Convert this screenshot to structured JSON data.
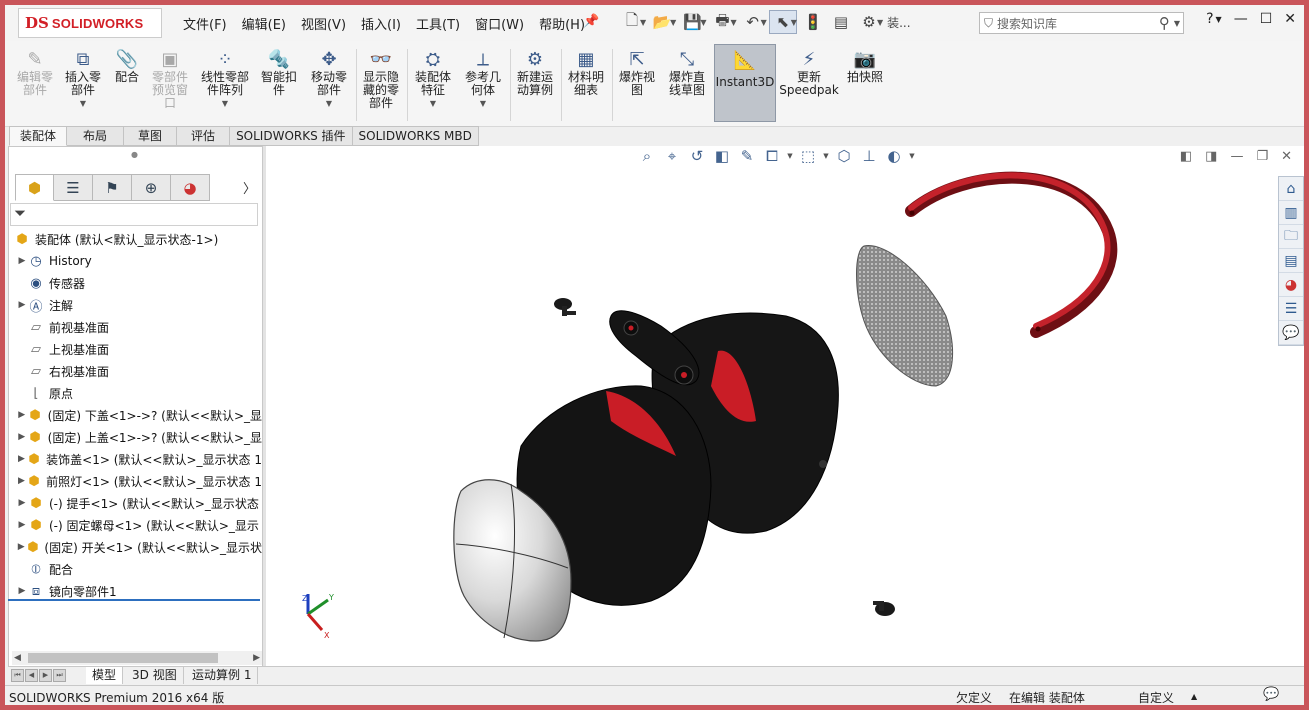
{
  "app": {
    "logo_ds": "DS",
    "logo_text": "SOLIDWORKS"
  },
  "menu": [
    "文件(F)",
    "编辑(E)",
    "视图(V)",
    "插入(I)",
    "工具(T)",
    "窗口(W)",
    "帮助(H)"
  ],
  "quick_access": {
    "assembly_label": "装...",
    "search_placeholder": "搜索知识库",
    "help": "?"
  },
  "ribbon": {
    "buttons": [
      {
        "label": "编辑零\n部件",
        "icon": "edit-component-icon",
        "disabled": true
      },
      {
        "label": "插入零\n部件",
        "icon": "insert-component-icon",
        "disabled": false
      },
      {
        "label": "配合",
        "icon": "mate-icon",
        "disabled": false
      },
      {
        "label": "零部件\n预览窗\n口",
        "icon": "component-preview-icon",
        "disabled": true
      },
      {
        "label": "线性零部\n件阵列",
        "icon": "linear-pattern-icon",
        "disabled": false
      },
      {
        "label": "智能扣\n件",
        "icon": "smart-fasteners-icon",
        "disabled": false
      },
      {
        "label": "移动零\n部件",
        "icon": "move-component-icon",
        "disabled": false
      },
      {
        "label": "显示隐\n藏的零\n部件",
        "icon": "show-hidden-icon",
        "disabled": false
      },
      {
        "label": "装配体\n特征",
        "icon": "assembly-features-icon",
        "disabled": false
      },
      {
        "label": "参考几\n何体",
        "icon": "reference-geometry-icon",
        "disabled": false
      },
      {
        "label": "新建运\n动算例",
        "icon": "new-motion-study-icon",
        "disabled": false
      },
      {
        "label": "材料明\n细表",
        "icon": "bom-icon",
        "disabled": false
      },
      {
        "label": "爆炸视\n图",
        "icon": "exploded-view-icon",
        "disabled": false
      },
      {
        "label": "爆炸直\n线草图",
        "icon": "explode-line-sketch-icon",
        "disabled": false
      },
      {
        "label": "Instant3D",
        "icon": "instant3d-icon",
        "disabled": false,
        "active": true
      },
      {
        "label": "更新\nSpeedpak",
        "icon": "speedpak-icon",
        "disabled": false
      },
      {
        "label": "拍快照",
        "icon": "snapshot-icon",
        "disabled": false
      }
    ]
  },
  "command_tabs": [
    "装配体",
    "布局",
    "草图",
    "评估",
    "SOLIDWORKS 插件",
    "SOLIDWORKS MBD"
  ],
  "feature_tree": {
    "root": "装配体  (默认<默认_显示状态-1>)",
    "items": [
      {
        "label": "History",
        "icon": "history-icon",
        "expandable": true
      },
      {
        "label": "传感器",
        "icon": "sensor-icon",
        "expandable": false
      },
      {
        "label": "注解",
        "icon": "annotation-icon",
        "expandable": true
      },
      {
        "label": "前视基准面",
        "icon": "plane-icon",
        "expandable": false
      },
      {
        "label": "上视基准面",
        "icon": "plane-icon",
        "expandable": false
      },
      {
        "label": "右视基准面",
        "icon": "plane-icon",
        "expandable": false
      },
      {
        "label": "原点",
        "icon": "origin-icon",
        "expandable": false
      },
      {
        "label": "(固定) 下盖<1>->? (默认<<默认>_显",
        "icon": "part-icon",
        "expandable": true
      },
      {
        "label": "(固定) 上盖<1>->? (默认<<默认>_显",
        "icon": "part-icon",
        "expandable": true
      },
      {
        "label": "装饰盖<1> (默认<<默认>_显示状态 1",
        "icon": "part-icon",
        "expandable": true
      },
      {
        "label": "前照灯<1> (默认<<默认>_显示状态 1",
        "icon": "part-icon",
        "expandable": true
      },
      {
        "label": "(-) 提手<1> (默认<<默认>_显示状态",
        "icon": "part-icon",
        "expandable": true
      },
      {
        "label": "(-) 固定螺母<1> (默认<<默认>_显示",
        "icon": "part-icon",
        "expandable": true
      },
      {
        "label": "(固定) 开关<1> (默认<<默认>_显示状",
        "icon": "part-icon",
        "expandable": true
      },
      {
        "label": "配合",
        "icon": "mates-icon",
        "expandable": false
      },
      {
        "label": "镜向零部件1",
        "icon": "mirror-component-icon",
        "expandable": true
      }
    ]
  },
  "bottom_tabs": [
    "模型",
    "3D 视图",
    "运动算例 1"
  ],
  "triad": {
    "x": "X",
    "y": "Y",
    "z": "Z"
  },
  "status_bar": {
    "product": "SOLIDWORKS Premium 2016 x64 版",
    "underdefined": "欠定义",
    "editing": "在编辑 装配体",
    "custom": "自定义"
  }
}
